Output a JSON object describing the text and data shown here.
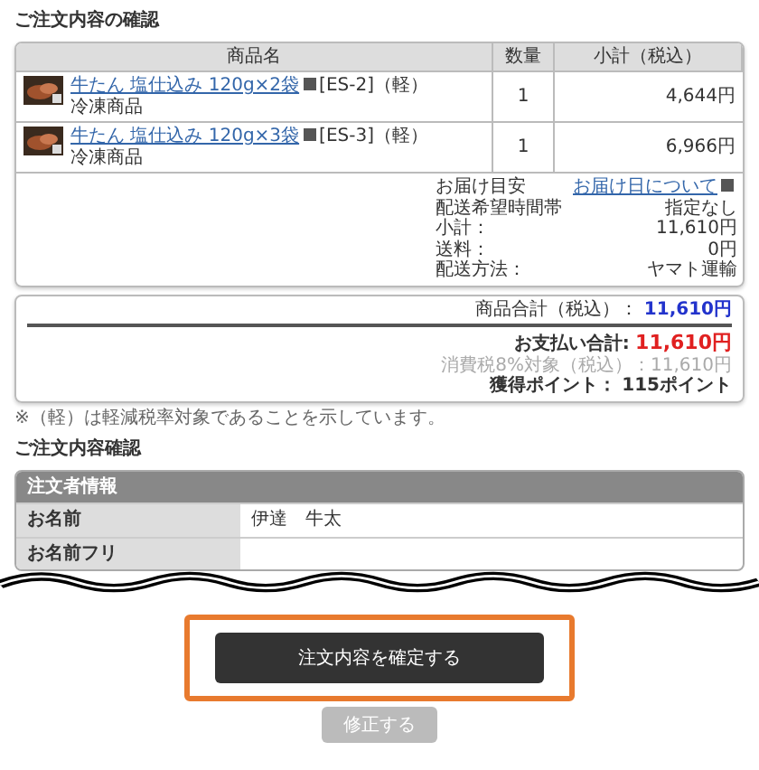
{
  "order_title": "ご注文内容の確認",
  "table": {
    "columns": [
      "商品名",
      "数量",
      "小計（税込）"
    ],
    "rows": [
      {
        "product": "牛たん 塩仕込み 120g×2袋",
        "code": "[ES-2]（軽）",
        "type": "冷凍商品",
        "qty": "1",
        "subtotal": "4,644円"
      },
      {
        "product": "牛たん 塩仕込み 120g×3袋",
        "code": "[ES-3]（軽）",
        "type": "冷凍商品",
        "qty": "1",
        "subtotal": "6,966円"
      }
    ]
  },
  "delivery": [
    {
      "label": "お届け目安",
      "value": "お届け日について",
      "kind": "link"
    },
    {
      "label": "配送希望時間帯",
      "value": "指定なし",
      "kind": "text"
    },
    {
      "label": "小計：",
      "value": "11,610円",
      "kind": "text"
    },
    {
      "label": "送料：",
      "value": "0円",
      "kind": "text"
    },
    {
      "label": "配送方法：",
      "value": "ヤマト運輸",
      "kind": "text"
    }
  ],
  "totals": {
    "goods_label": "商品合計（税込）：",
    "goods_value": "11,610円",
    "pay_label": "お支払い合計:",
    "pay_value": "11,610円",
    "tax_note": "消費税8%対象（税込）：11,610円",
    "points_label": "獲得ポイント：",
    "points_value": "115ポイント"
  },
  "note": "※（軽）は軽減税率対象であることを示しています。",
  "info_title": "ご注文内容確認",
  "info": {
    "header": "注文者情報",
    "rows": [
      {
        "label": "お名前",
        "value": "伊達　牛太"
      },
      {
        "label": "お名前フリ"
      }
    ]
  },
  "buttons": [
    {
      "label": "注文内容を確定する",
      "kind": "primary",
      "highlighted": true
    },
    {
      "label": "修正する",
      "kind": "secondary",
      "highlighted": false
    }
  ]
}
